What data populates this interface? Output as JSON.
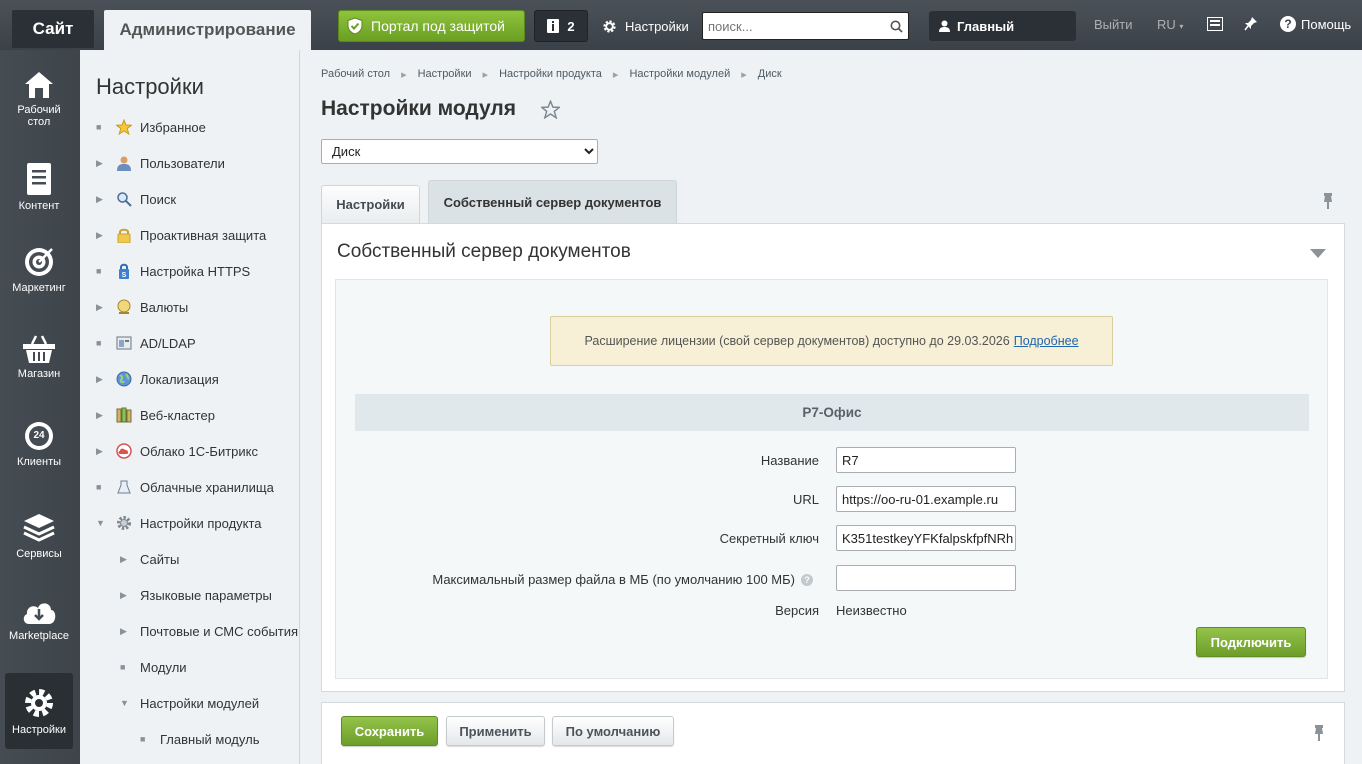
{
  "topbar": {
    "site_label": "Сайт",
    "admin_label": "Администрирование",
    "portal_label": "Портал под защитой",
    "notif_count": "2",
    "settings_label": "Настройки",
    "search_placeholder": "поиск...",
    "user_label": "Главный",
    "logout_label": "Выйти",
    "lang_label": "RU",
    "help_label": "Помощь"
  },
  "leftmenu": [
    {
      "label": "Рабочий стол"
    },
    {
      "label": "Контент"
    },
    {
      "label": "Маркетинг"
    },
    {
      "label": "Магазин"
    },
    {
      "label": "Клиенты"
    },
    {
      "label": "Сервисы"
    },
    {
      "label": "Marketplace"
    },
    {
      "label": "Настройки"
    }
  ],
  "clients_badge": "24",
  "sidebar": {
    "title": "Настройки",
    "items": [
      {
        "label": "Избранное"
      },
      {
        "label": "Пользователи"
      },
      {
        "label": "Поиск"
      },
      {
        "label": "Проактивная защита"
      },
      {
        "label": "Настройка HTTPS"
      },
      {
        "label": "Валюты"
      },
      {
        "label": "AD/LDAP"
      },
      {
        "label": "Локализация"
      },
      {
        "label": "Веб-кластер"
      },
      {
        "label": "Облако 1С-Битрикс"
      },
      {
        "label": "Облачные хранилища"
      },
      {
        "label": "Настройки продукта"
      },
      {
        "label": "Сайты"
      },
      {
        "label": "Языковые параметры"
      },
      {
        "label": "Почтовые и СМС события"
      },
      {
        "label": "Модули"
      },
      {
        "label": "Настройки модулей"
      },
      {
        "label": "Главный модуль"
      }
    ]
  },
  "breadcrumb": [
    "Рабочий стол",
    "Настройки",
    "Настройки продукта",
    "Настройки модулей",
    "Диск"
  ],
  "page_title": "Настройки модуля",
  "module_select": "Диск",
  "tabs": [
    {
      "label": "Настройки"
    },
    {
      "label": "Собственный сервер документов"
    }
  ],
  "panel": {
    "heading": "Собственный сервер документов",
    "notice_text": "Расширение лицензии (свой сервер документов) доступно до 29.03.2026",
    "notice_link": "Подробнее",
    "section_title": "Р7-Офис",
    "fields": {
      "name_label": "Название",
      "name_value": "R7",
      "url_label": "URL",
      "url_value": "https://oo-ru-01.example.ru",
      "secret_label": "Секретный ключ",
      "secret_value": "K351testkeyYFKfalpskfpfNRh",
      "maxsize_label": "Максимальный размер файла в МБ (по умолчанию 100 МБ)",
      "maxsize_value": "",
      "version_label": "Версия",
      "version_value": "Неизвестно"
    },
    "connect_label": "Подключить"
  },
  "footer": {
    "save_label": "Сохранить",
    "apply_label": "Применить",
    "default_label": "По умолчанию"
  },
  "colors": {
    "topbar": "#3b4148",
    "green": "#6d9e2a",
    "notice_bg": "#f7f0d6",
    "link": "#2067b0"
  }
}
